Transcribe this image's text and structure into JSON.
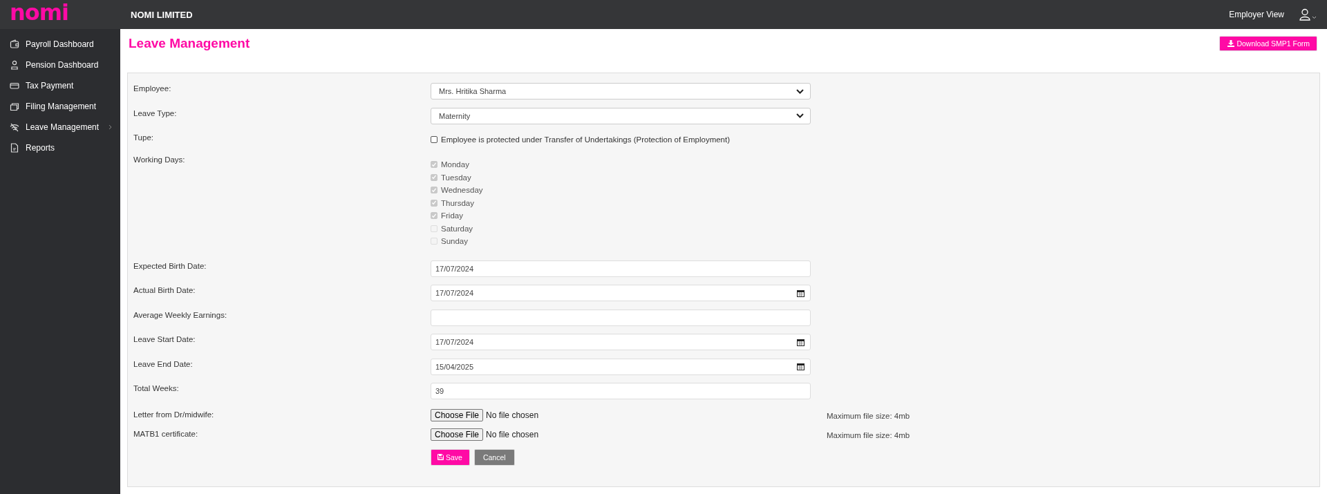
{
  "header": {
    "logo": "nomi",
    "company": "NOMI LIMITED",
    "view_label": "Employer View"
  },
  "sidebar": {
    "items": [
      {
        "label": "Payroll Dashboard",
        "kind": "wallet",
        "has_submenu": false
      },
      {
        "label": "Pension Dashboard",
        "kind": "person",
        "has_submenu": false
      },
      {
        "label": "Tax Payment",
        "kind": "card",
        "has_submenu": false
      },
      {
        "label": "Filing Management",
        "kind": "folders",
        "has_submenu": false
      },
      {
        "label": "Leave Management",
        "kind": "signal",
        "has_submenu": true
      },
      {
        "label": "Reports",
        "kind": "document",
        "has_submenu": false
      }
    ]
  },
  "page": {
    "title": "Leave Management",
    "download_button": "Download SMP1 Form"
  },
  "form": {
    "fields": [
      {
        "kind": "select",
        "label": "Employee:",
        "value": "Mrs. Hritika Sharma"
      },
      {
        "kind": "select",
        "label": "Leave Type:",
        "value": "Maternity"
      },
      {
        "kind": "checkbox",
        "label": "Tupe:",
        "option": {
          "label": "Employee is protected under Transfer of Undertakings (Protection of Employment)",
          "checked": false,
          "disabled": false
        }
      },
      {
        "kind": "checkbox_group",
        "label": "Working Days:",
        "options": [
          {
            "label": "Monday",
            "checked": true,
            "disabled": true
          },
          {
            "label": "Tuesday",
            "checked": true,
            "disabled": true
          },
          {
            "label": "Wednesday",
            "checked": true,
            "disabled": true
          },
          {
            "label": "Thursday",
            "checked": true,
            "disabled": true
          },
          {
            "label": "Friday",
            "checked": true,
            "disabled": true
          },
          {
            "label": "Saturday",
            "checked": false,
            "disabled": true
          },
          {
            "label": "Sunday",
            "checked": false,
            "disabled": true
          }
        ]
      },
      {
        "kind": "text",
        "label": "Expected Birth Date:",
        "value": "17/07/2024"
      },
      {
        "kind": "date",
        "label": "Actual Birth Date:",
        "value": "17/07/2024"
      },
      {
        "kind": "text",
        "label": "Average Weekly Earnings:"
      },
      {
        "kind": "date",
        "label": "Leave Start Date:",
        "value": "17/07/2024"
      },
      {
        "kind": "date",
        "label": "Leave End Date:",
        "value": "15/04/2025"
      },
      {
        "kind": "text",
        "label": "Total Weeks:",
        "value": "39"
      },
      {
        "kind": "file",
        "label": "Letter from Dr/midwife:",
        "button": "Choose File",
        "status": "No file chosen",
        "note": "Maximum file size: 4mb"
      },
      {
        "kind": "file",
        "label": "MATB1 certificate:",
        "button": "Choose File",
        "status": "No file chosen",
        "note": "Maximum file size: 4mb"
      }
    ],
    "buttons": [
      {
        "kind": "primary",
        "label": "Save"
      },
      {
        "kind": "secondary",
        "label": "Cancel"
      }
    ]
  }
}
